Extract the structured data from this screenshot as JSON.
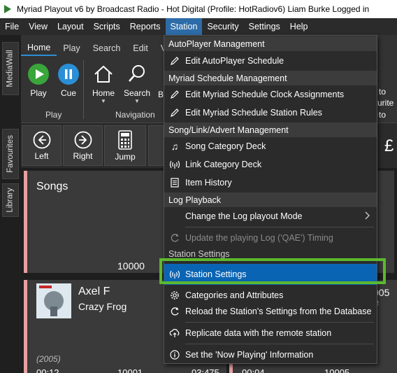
{
  "window": {
    "title": "Myriad Playout v6 by Broadcast Radio - Hot Digital (Profile: HotRadiov6) Liam Burke Logged in"
  },
  "menubar": {
    "items": [
      "File",
      "View",
      "Layout",
      "Scripts",
      "Reports",
      "Station",
      "Security",
      "Settings",
      "Help"
    ],
    "active": "Station"
  },
  "side_tabs": [
    "MediaWall",
    "Favourites",
    "Library"
  ],
  "ribbon": {
    "tabs": [
      "Home",
      "Play",
      "Search",
      "Edit",
      "V"
    ],
    "buttons": {
      "play": "Play",
      "cue": "Cue",
      "home": "Home",
      "search": "Search",
      "b": "B"
    },
    "groups": {
      "play": "Play",
      "navigation": "Navigation"
    },
    "right_text": {
      "to": "to",
      "urite": "urite",
      "to2": "to"
    }
  },
  "nav_buttons": {
    "left": "Left",
    "right": "Right",
    "jump": "Jump"
  },
  "content": {
    "songs": {
      "title": "Songs",
      "count": "10000"
    },
    "track": {
      "title": "Axel F",
      "artist": "Crazy Frog",
      "year": "(2005)",
      "bottom_left": "00:12",
      "bottom_mid": "10001",
      "bottom_right": "03:475",
      "right_a": "00:04",
      "right_b": "10005",
      "right_edge": "005 #"
    }
  },
  "station_menu": {
    "headers": {
      "autoplayer": "AutoPlayer Management",
      "schedule": "Myriad Schedule Management",
      "songlink": "Song/Link/Advert Management",
      "log": "Log Playback",
      "station": "Station Settings"
    },
    "items": {
      "edit_autoplayer": "Edit AutoPlayer Schedule",
      "clock_assign": "Edit Myriad Schedule Clock Assignments",
      "station_rules": "Edit Myriad Schedule Station Rules",
      "song_deck": "Song Category Deck",
      "link_deck": "Link Category Deck",
      "item_history": "Item History",
      "change_log": "Change the Log playout Mode",
      "update_log": "Update the playing Log ('QAE') Timing",
      "station_settings": "Station Settings",
      "categories": "Categories and Attributes",
      "reload": "Reload the Station's Settings from the Database",
      "replicate": "Replicate data with the remote station",
      "now_playing": "Set the 'Now Playing' Information"
    }
  },
  "colors": {
    "accent": "#0a64b4",
    "highlight": "#5cb82e",
    "menu_active": "#2d6ca8"
  }
}
